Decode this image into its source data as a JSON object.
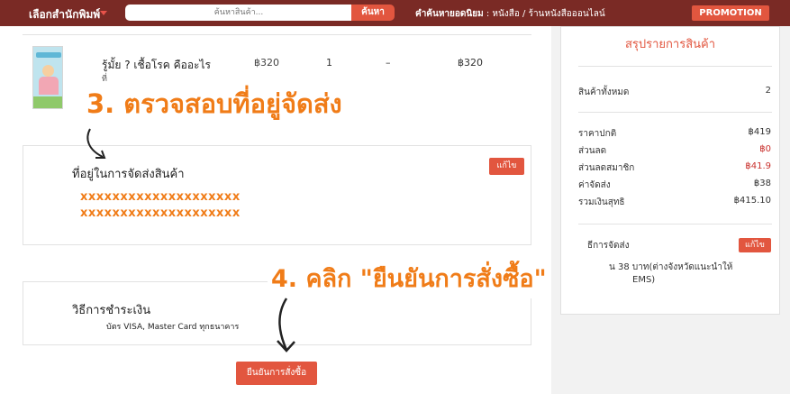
{
  "header": {
    "publisher_select": "เลือกสำนักพิมพ์",
    "search_placeholder": "ค้นหาสินค้า...",
    "search_button": "ค้นหา",
    "popular_label": "คำค้นหายอดนิยม",
    "popular_links": ": หนังสือ / ร้านหนังสือออนไลน์",
    "promotion_button": "PROMOTION"
  },
  "product": {
    "name": "รู้มั้ย ? เชื้อโรค คือ",
    "name_tail": "อะไร",
    "subtitle": "ที่",
    "price": "฿320",
    "quantity": "1",
    "discount": "–",
    "total": "฿320"
  },
  "annotations": {
    "step3": "3. ตรวจสอบที่อยู่จัดส่ง",
    "step4": "4. คลิก \"ยืนยันการสั่งซื้อ\""
  },
  "address": {
    "title": "ที่อยู่ในการจัดส่งสินค้า",
    "line1": "xxxxxxxxxxxxxxxxxxxx",
    "line2": "xxxxxxxxxxxxxxxxxxxx",
    "edit_button": "แก้ไข"
  },
  "payment": {
    "title": "วิธีการชำระเงิน",
    "description": "บัตร VISA, Master Card ทุกธนาคาร"
  },
  "confirm_button": "ยืนยันการสั่งซื้อ",
  "summary": {
    "title": "สรุปรายการสินค้า",
    "item_count_label": "สินค้าทั้งหมด",
    "item_count": "2",
    "rows": [
      {
        "label": "ราคาปกติ",
        "value": "฿419"
      },
      {
        "label": "ส่วนลด",
        "value": "฿0"
      },
      {
        "label": "ส่วนลดสมาชิก",
        "value": "฿41.9"
      },
      {
        "label": "ค่าจัดส่ง",
        "value": "฿38"
      },
      {
        "label": "รวมเงินสุทธิ",
        "value": "฿415.10"
      }
    ],
    "shipping_label": "ธีการจัดส่ง",
    "shipping_edit": "แก้ไข",
    "shipping_line1": "น 38 บาท(ต่างจังหวัดแนะนำให้",
    "shipping_line2": "EMS)"
  },
  "colors": {
    "topbar": "#7a2a25",
    "accent": "#e2563f",
    "annotation": "#f07c18"
  }
}
